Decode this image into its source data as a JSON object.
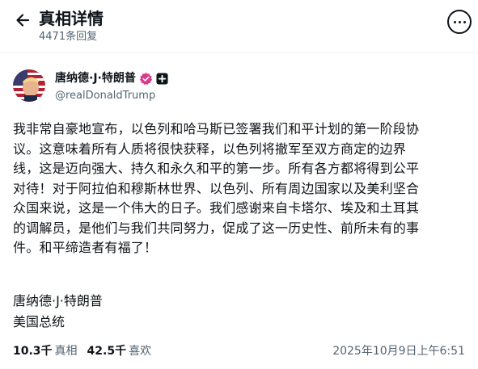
{
  "header": {
    "title": "真相详情",
    "reply_count": "4471条回复"
  },
  "author": {
    "name": "唐纳德·J·特朗普",
    "handle": "@realDonaldTrump"
  },
  "post": {
    "lines": [
      "我非常自豪地宣布，以色列和哈马斯已签署我们和平计划的第一阶段协",
      "议。这意味着所有人质将很快获释，以色列将撤军至双方商定的边界",
      "线，这是迈向强大、持久和永久和平的第一步。所有各方都将得到公平",
      "对待！对于阿拉伯和穆斯林世界、以色列、所有周边国家以及美利坚合",
      "众国来说，这是一个伟大的日子。我们感谢来自卡塔尔、埃及和土耳其",
      "的调解员，是他们与我们共同努力，促成了这一历史性、前所未有的事",
      "件。和平缔造者有福了！"
    ],
    "signature_name": "唐纳德·J·特朗普",
    "signature_title": "美国总统"
  },
  "stats": {
    "views_value": "10.3千",
    "views_label": "真相",
    "likes_value": "42.5千",
    "likes_label": "喜欢",
    "timestamp": "2025年10月9日上午6:51"
  },
  "colors": {
    "text": "#0f1419",
    "secondary": "#536471",
    "verified_badge": "#d63d8a"
  },
  "icons": [
    "back-arrow-icon",
    "more-icon",
    "verified-icon",
    "government-badge-icon"
  ]
}
